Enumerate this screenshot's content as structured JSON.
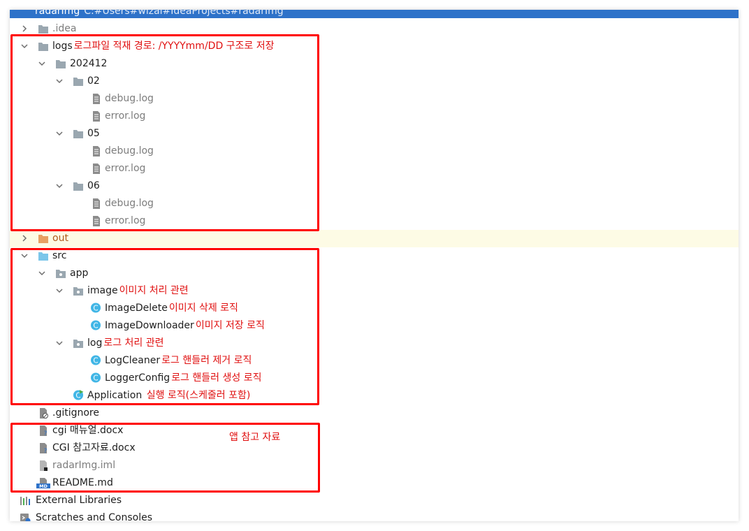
{
  "header": {
    "project": "radarImg",
    "path": "C:#Users#wizai#IdeaProjects#radarImg"
  },
  "colors": {
    "folder": "#9aa7b0",
    "out_folder": "#e8a062",
    "src_folder": "#7cc6ea",
    "class_icon": "#41b6e6",
    "annotation": "#e01010",
    "box": "#ff0000"
  },
  "tree": {
    "idea": ".idea",
    "logs": "logs",
    "logs_note": "로그파일 적재 경로: /YYYYmm/DD 구조로 저장",
    "month": "202412",
    "d02": "02",
    "d05": "05",
    "d06": "06",
    "debug": "debug.log",
    "error": "error.log",
    "out": "out",
    "src": "src",
    "app": "app",
    "image": "image",
    "image_note": "이미지 처리 관련",
    "image_delete": "ImageDelete",
    "image_delete_note": "이미지 삭제 로직",
    "image_downloader": "ImageDownloader",
    "image_downloader_note": "이미지 저장 로직",
    "log": "log",
    "log_note": "로그 처리 관련",
    "log_cleaner": "LogCleaner",
    "log_cleaner_note": "로그 핸들러 제거 로직",
    "logger_config": "LoggerConfig",
    "logger_config_note": "로그 핸들러 생성 로직",
    "application": "Application",
    "application_note": "실행 로직(스케줄러 포함)",
    "gitignore": ".gitignore",
    "cgi_manual": "cgi 매뉴얼.docx",
    "cgi_ref": "CGI 참고자료.docx",
    "iml": "radarImg.iml",
    "readme": "README.md",
    "external": "External Libraries",
    "scratches": "Scratches and Consoles",
    "app_note": "앱 참고 자료"
  }
}
